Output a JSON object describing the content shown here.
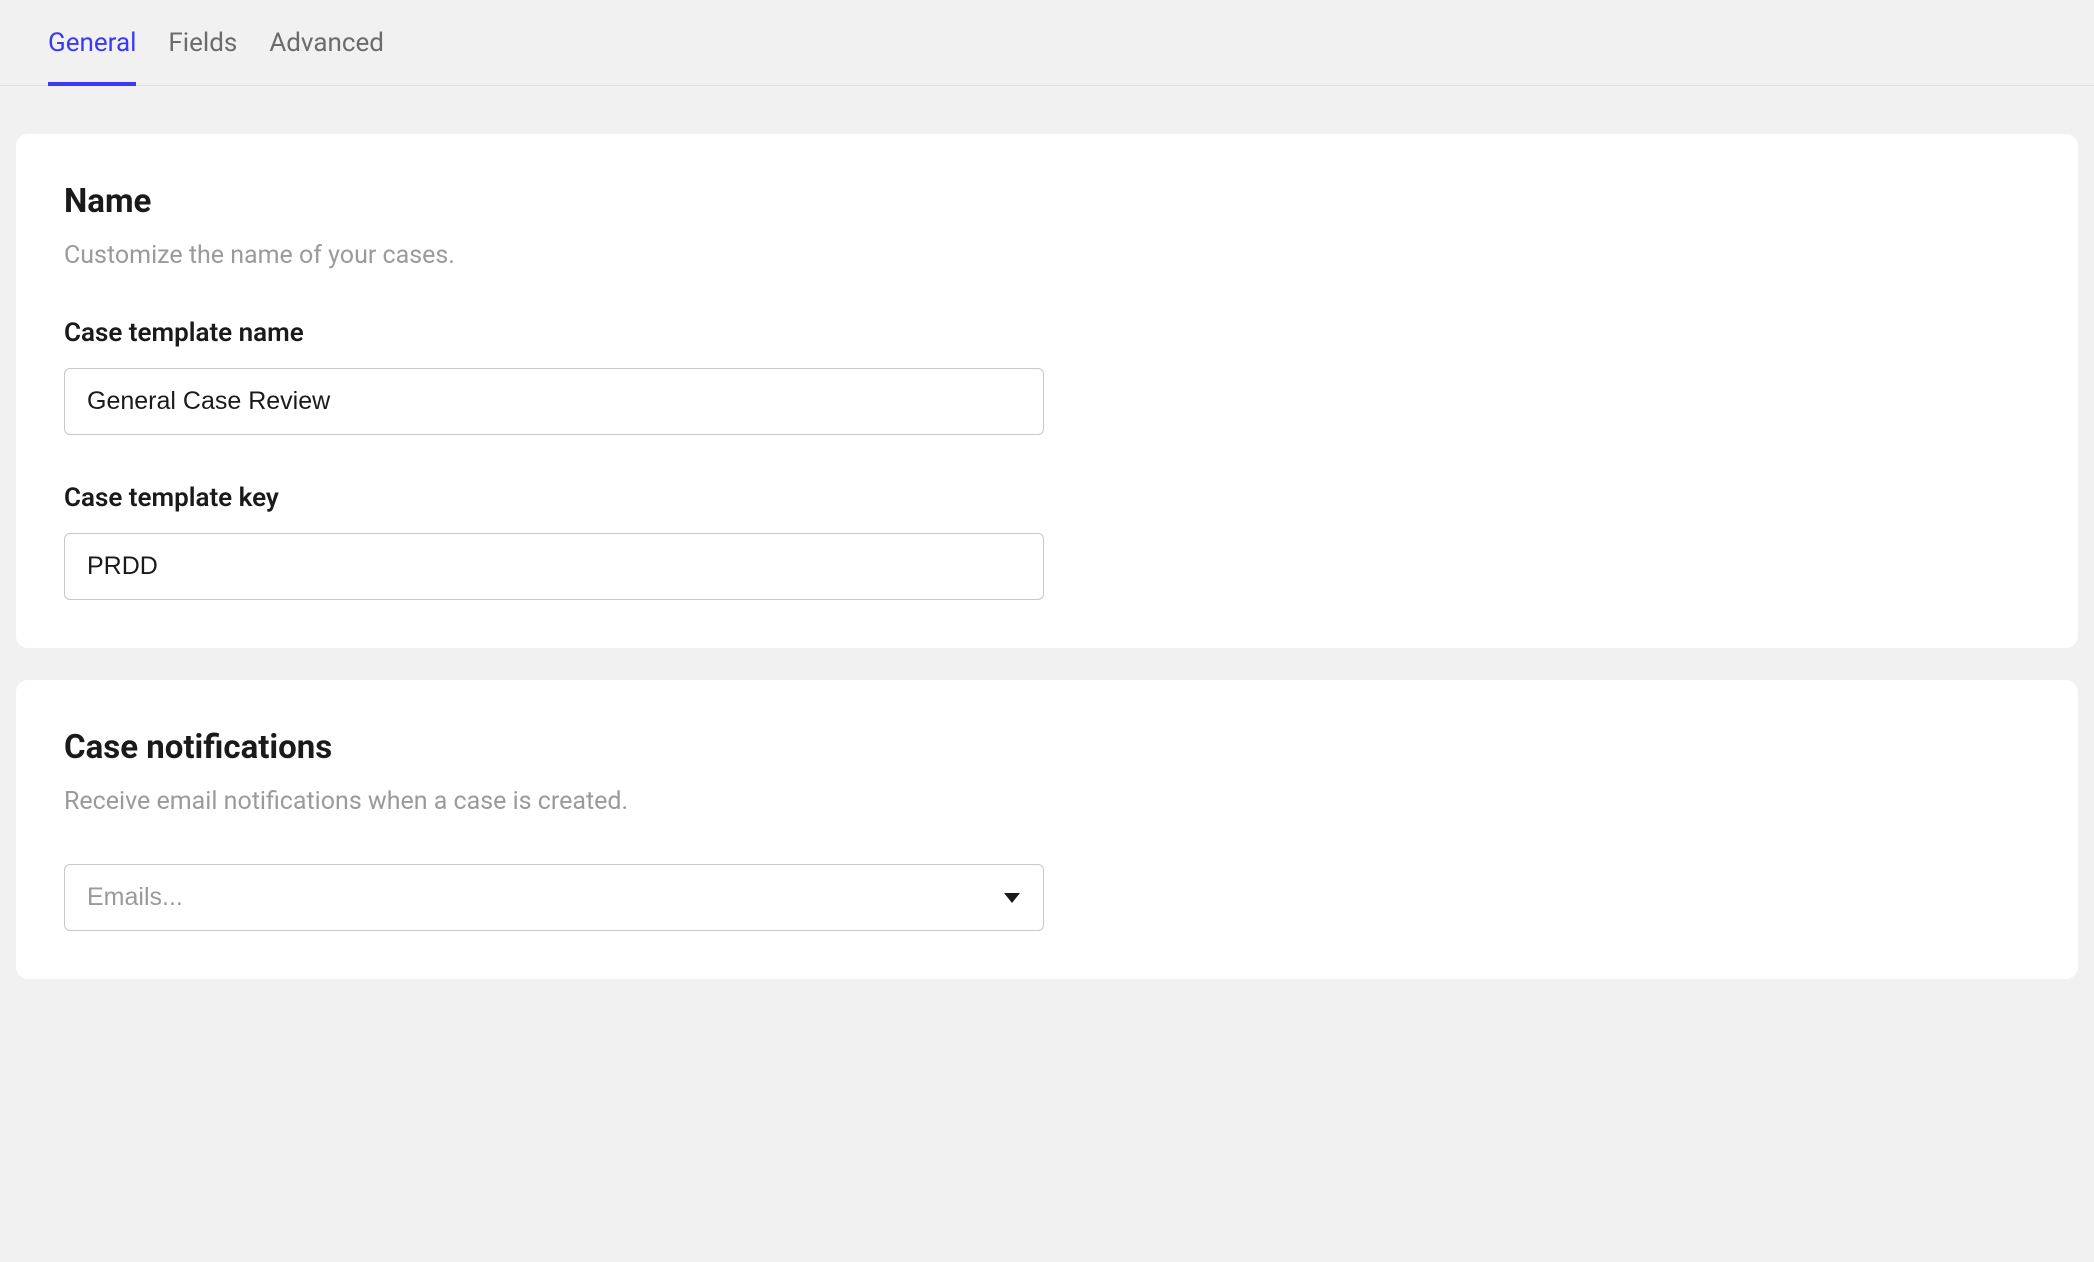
{
  "tabs": [
    {
      "label": "General",
      "active": true
    },
    {
      "label": "Fields",
      "active": false
    },
    {
      "label": "Advanced",
      "active": false
    }
  ],
  "name_section": {
    "title": "Name",
    "description": "Customize the name of your cases.",
    "template_name": {
      "label": "Case template name",
      "value": "General Case Review"
    },
    "template_key": {
      "label": "Case template key",
      "value": "PRDD"
    }
  },
  "notifications_section": {
    "title": "Case notifications",
    "description": "Receive email notifications when a case is created.",
    "emails_select": {
      "placeholder": "Emails..."
    }
  }
}
